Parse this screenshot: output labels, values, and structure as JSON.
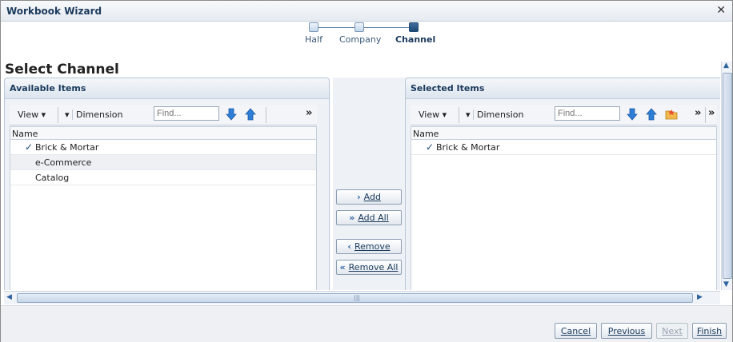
{
  "window": {
    "title": "Workbook Wizard",
    "close": "✕"
  },
  "train": {
    "steps": [
      {
        "label": "Half"
      },
      {
        "label": "Company"
      },
      {
        "label": "Channel"
      }
    ]
  },
  "page_title": "Select Channel",
  "available": {
    "header": "Available Items",
    "toolbar": {
      "view": "View",
      "dimension": "Dimension",
      "find_placeholder": "Find...",
      "more": "»"
    },
    "column": "Name",
    "rows": [
      {
        "label": "Brick & Mortar",
        "checked": true
      },
      {
        "label": "e-Commerce",
        "checked": false
      },
      {
        "label": "Catalog",
        "checked": false
      }
    ]
  },
  "selected": {
    "header": "Selected Items",
    "toolbar": {
      "view": "View",
      "dimension": "Dimension",
      "find_placeholder": "Find...",
      "more": "»",
      "more2": "»"
    },
    "column": "Name",
    "rows": [
      {
        "label": "Brick & Mortar",
        "checked": true
      }
    ]
  },
  "shuttle": {
    "add": "Add",
    "add_all": "Add All",
    "remove": "Remove",
    "remove_all": "Remove All"
  },
  "footer": {
    "cancel": "Cancel",
    "previous": "Previous",
    "next": "Next",
    "finish": "Finish"
  },
  "icons": {
    "arrow_down": "arrow-down-icon",
    "arrow_up": "arrow-up-icon",
    "folder": "folder-icon"
  },
  "colors": {
    "accent": "#1c4874",
    "arrow": "#2e7dd6"
  }
}
